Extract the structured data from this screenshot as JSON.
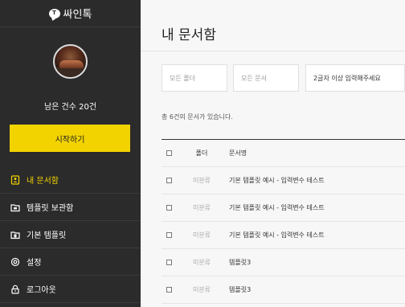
{
  "app": {
    "name": "싸인톡",
    "logo_mark": "T"
  },
  "sidebar": {
    "remaining_text": "남은 건수 20건",
    "start_button": "시작하기",
    "accent_color": "#f2d300",
    "nav": [
      {
        "label": "내 문서함",
        "icon": "user-doc-icon",
        "active": true
      },
      {
        "label": "템플릿 보관함",
        "icon": "folder-box-icon",
        "active": false
      },
      {
        "label": "기본 템플릿",
        "icon": "folder-doc-icon",
        "active": false
      },
      {
        "label": "설정",
        "icon": "gear-icon",
        "active": false
      },
      {
        "label": "로그아웃",
        "icon": "lock-icon",
        "active": false
      }
    ]
  },
  "main": {
    "title": "내 문서함",
    "filters": {
      "folder": "모든 폴더",
      "document": "모든 문서",
      "search_placeholder": "2글자 이상 입력해주세요"
    },
    "count_text": "총 6건의 문서가 있습니다.",
    "table": {
      "headers": {
        "folder": "폴더",
        "name": "문서명"
      },
      "rows": [
        {
          "folder": "미분류",
          "name": "기본 템플릿 예시 - 입력변수 테스트"
        },
        {
          "folder": "미분류",
          "name": "기본 템플릿 예시 - 입력변수 테스트"
        },
        {
          "folder": "미분류",
          "name": "기본 템플릿 예시 - 입력변수 테스트"
        },
        {
          "folder": "미분류",
          "name": "템플릿3"
        },
        {
          "folder": "미분류",
          "name": "템플릿3"
        }
      ]
    }
  }
}
